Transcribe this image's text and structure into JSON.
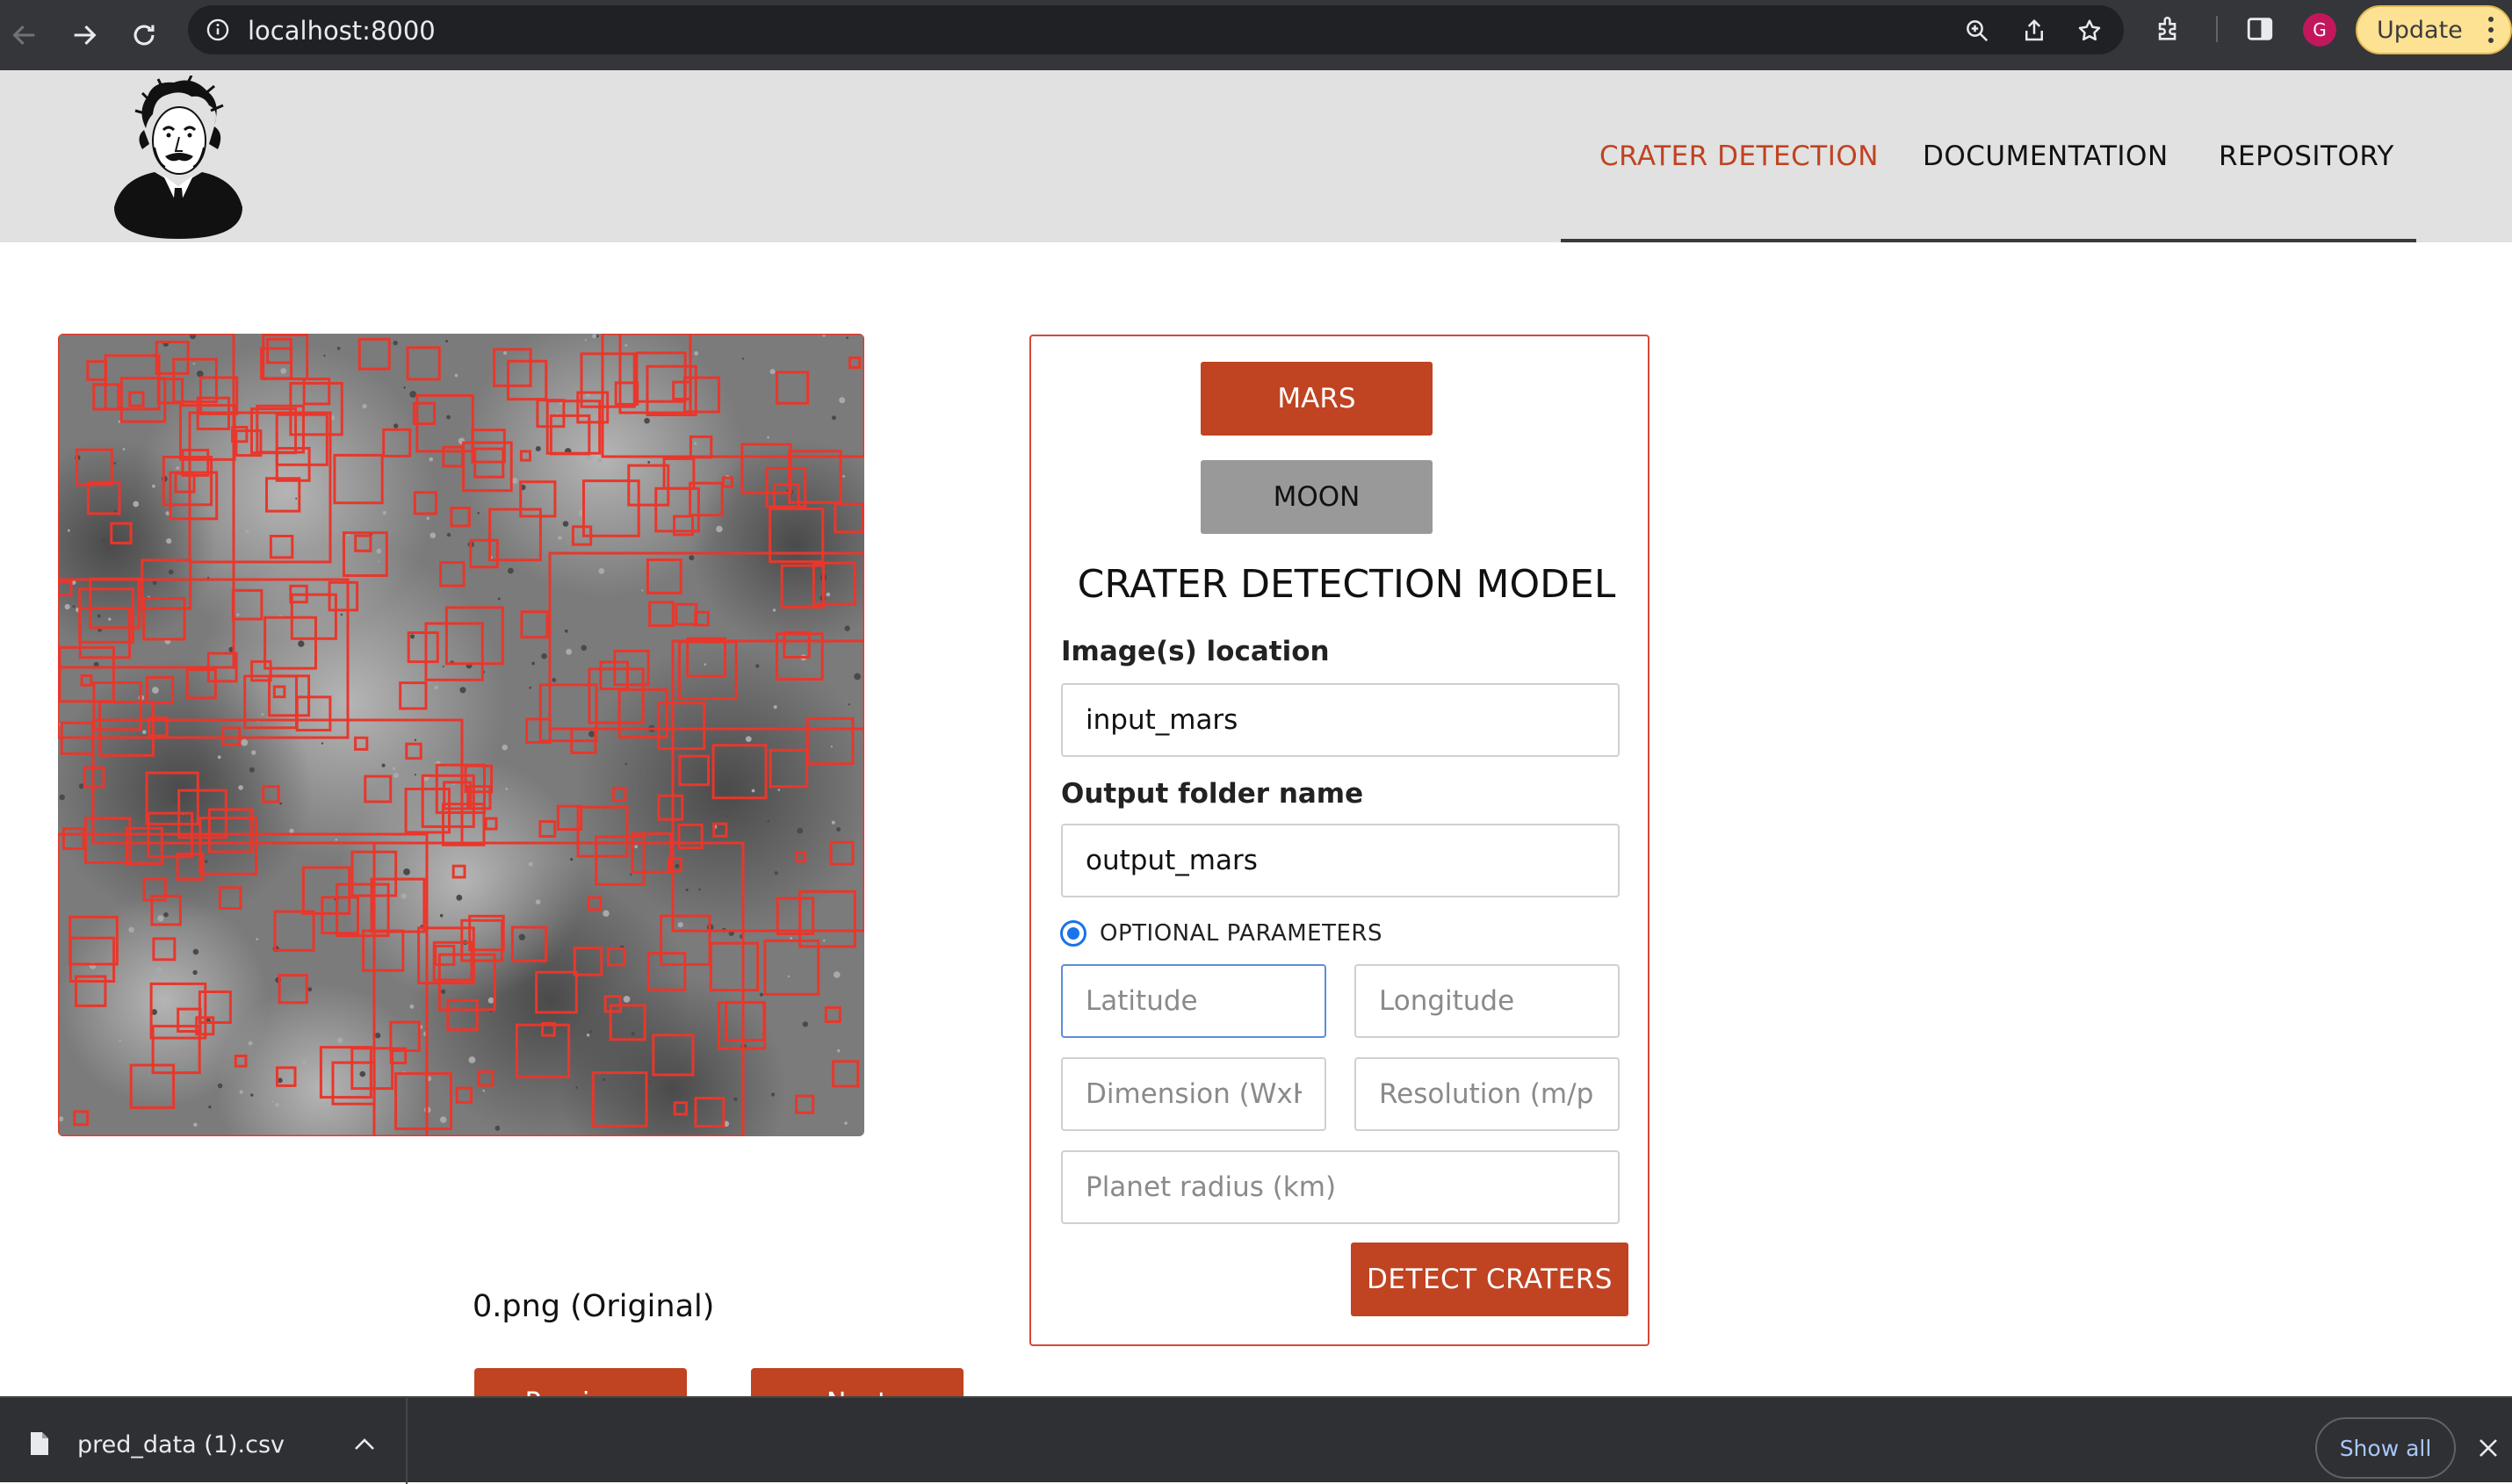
{
  "browser": {
    "url": "localhost:8000",
    "profile_initial": "G",
    "update_label": "Update",
    "icons": [
      "back-icon",
      "forward-icon",
      "reload-icon",
      "info-icon",
      "zoom-icon",
      "share-icon",
      "star-icon",
      "extensions-icon",
      "sidepanel-icon",
      "menu-icon"
    ]
  },
  "header": {
    "logo": "einstein-logo",
    "nav": [
      {
        "label": "CRATER DETECTION",
        "active": true
      },
      {
        "label": "DOCUMENTATION",
        "active": false
      },
      {
        "label": "REPOSITORY",
        "active": false
      }
    ]
  },
  "viewer": {
    "caption": "0.png (Original)",
    "prev_label": "Previous",
    "next_label": "Next"
  },
  "form": {
    "planets": {
      "mars": "MARS",
      "moon": "MOON"
    },
    "title": "CRATER DETECTION MODEL",
    "image_location_label": "Image(s) location",
    "image_location_value": "input_mars",
    "output_folder_label": "Output folder name",
    "output_folder_value": "output_mars",
    "optional_label": "OPTIONAL PARAMETERS",
    "placeholders": {
      "latitude": "Latitude",
      "longitude": "Longitude",
      "dimension": "Dimension (WxH)",
      "resolution": "Resolution (m/pix)",
      "radius": "Planet radius (km)"
    },
    "detect_label": "DETECT CRATERS"
  },
  "downloads": {
    "file_name": "pred_data (1).csv",
    "show_all_label": "Show all"
  },
  "colors": {
    "accent": "#c04322",
    "nav_underline": "#3a3a3a",
    "panel_border": "#d6483a",
    "header_bg": "#e1e1e1"
  }
}
